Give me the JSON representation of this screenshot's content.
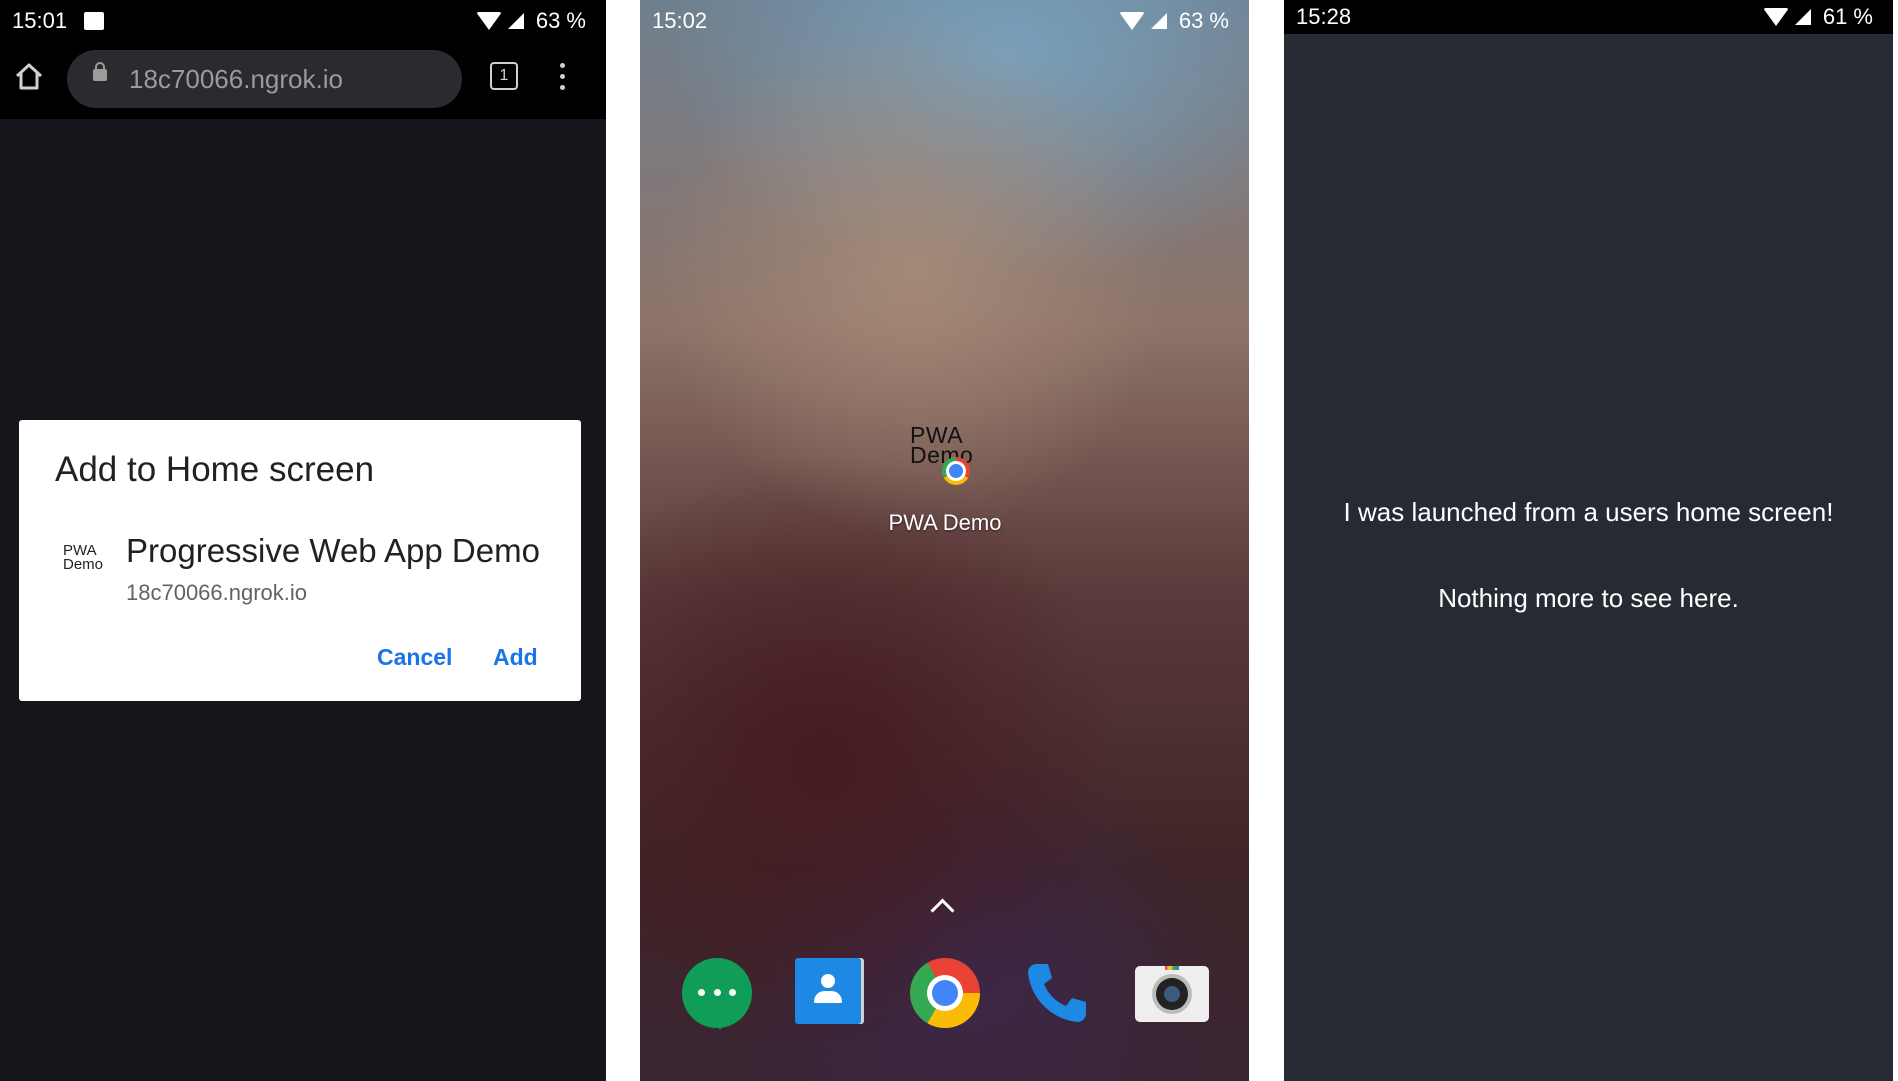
{
  "phone1": {
    "status": {
      "time": "15:01",
      "battery": "63 %"
    },
    "browser": {
      "url": "18c70066.ngrok.io",
      "tab_count": "1"
    },
    "dialog": {
      "title": "Add to Home screen",
      "icon_text": "PWA Demo",
      "app_name": "Progressive Web App Demo",
      "app_url": "18c70066.ngrok.io",
      "cancel_label": "Cancel",
      "add_label": "Add"
    }
  },
  "phone2": {
    "status": {
      "time": "15:02",
      "battery": "63 %"
    },
    "shortcut": {
      "icon_text_line1": "PWA",
      "icon_text_line2": "Demo",
      "label": "PWA Demo"
    },
    "dock": [
      "hangouts",
      "contacts",
      "chrome",
      "phone",
      "camera"
    ]
  },
  "phone3": {
    "status": {
      "time": "15:28",
      "battery": "61 %"
    },
    "message1": "I was launched from a users home screen!",
    "message2": "Nothing more to see here."
  },
  "colors": {
    "accent": "#1a73e8",
    "dark_bg": "#15161c",
    "app_bg": "#262a33"
  }
}
